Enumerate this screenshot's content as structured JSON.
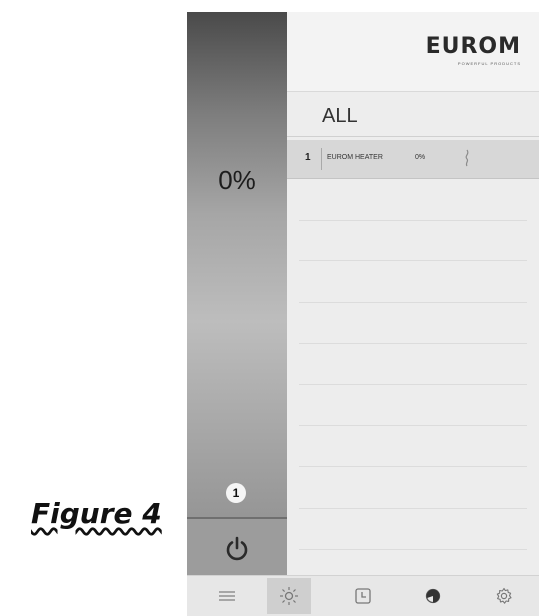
{
  "caption": "Figure 4",
  "left_panel": {
    "percentage": "0%",
    "zone_number": "1"
  },
  "brand": {
    "name": "EUROM",
    "tagline": "POWERFUL PRODUCTS"
  },
  "list": {
    "title": "ALL",
    "devices": [
      {
        "number": "1",
        "name": "EUROM HEATER",
        "percent": "0%"
      }
    ]
  },
  "tabs": [
    {
      "icon": "list-icon",
      "active": false
    },
    {
      "icon": "sun-icon",
      "active": true
    },
    {
      "icon": "clock-icon",
      "active": false
    },
    {
      "icon": "half-circle-icon",
      "active": false
    },
    {
      "icon": "gear-icon",
      "active": false
    }
  ],
  "colors": {
    "accent_active_tab": "#cfcfcf",
    "icon_color": "#777777"
  }
}
